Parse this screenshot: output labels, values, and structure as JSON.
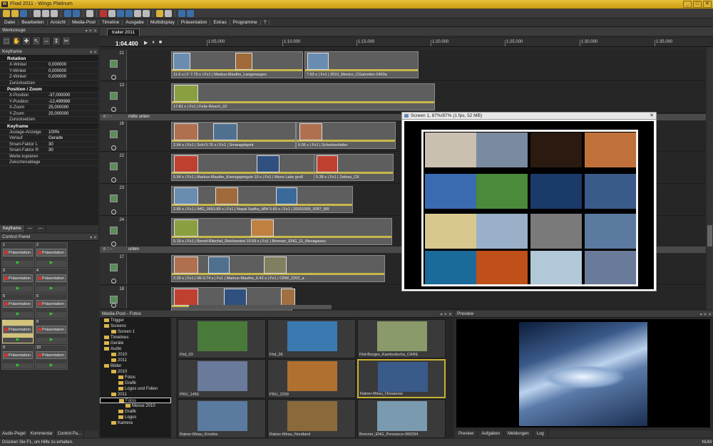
{
  "app": {
    "title": "Fhad 2011 - Wings Platinum",
    "logo": "W"
  },
  "window_controls": [
    "_",
    "□",
    "✕"
  ],
  "menu": [
    "Datei",
    "Bearbeiten",
    "Ansicht",
    "Media-Pool",
    "Timeline",
    "Ausgabe",
    "Multidisplay",
    "Präsentation",
    "Extras",
    "Programme",
    "?"
  ],
  "werkzeuge": {
    "title": "Werkzeuge",
    "tools": [
      "⬚",
      "✋",
      "✚",
      "↖",
      "⇔",
      "⇕",
      "✂"
    ]
  },
  "keyframe": {
    "title": "Keyframe",
    "groups": [
      {
        "name": "Rotation",
        "rows": [
          [
            "X-Winkel",
            "0,000000"
          ],
          [
            "Y-Winkel",
            "0,000000"
          ],
          [
            "Z-Winkel",
            "0,000000"
          ],
          [
            "Zurücksetzen",
            ""
          ]
        ]
      },
      {
        "name": "Position / Zoom",
        "rows": [
          [
            "X-Position",
            "-37,000000"
          ],
          [
            "Y-Position",
            "-12,499989"
          ],
          [
            "X-Zoom",
            "25,000000"
          ],
          [
            "Y-Zoom",
            "25,000000"
          ],
          [
            "Zurücksetzen",
            ""
          ]
        ]
      },
      {
        "name": "Keyframe",
        "rows": [
          [
            "Justage-Anzeige",
            "100%"
          ],
          [
            "Verlauf",
            "Gerade"
          ],
          [
            "Smart-Faktor L",
            "30"
          ],
          [
            "Smart-Faktor R",
            "30"
          ],
          [
            "Werte kopieren",
            ""
          ],
          [
            "Zwischenablage",
            ""
          ]
        ]
      }
    ]
  },
  "left_tabs": [
    "Keyframe",
    "—",
    "—"
  ],
  "control_panel": {
    "title": "Control Panel",
    "cells": [
      {
        "num": "1",
        "label": "Präsentation"
      },
      {
        "num": "2",
        "label": "Präsentation"
      },
      {
        "num": "3",
        "label": "Präsentation"
      },
      {
        "num": "4",
        "label": "Präsentation"
      },
      {
        "num": "5",
        "label": "Präsentation"
      },
      {
        "num": "6",
        "label": "Präsentation"
      },
      {
        "num": "7",
        "label": "Präsentation"
      },
      {
        "num": "8",
        "label": "Präsentation"
      },
      {
        "num": "9",
        "label": "Präsentation"
      },
      {
        "num": "10",
        "label": "Präsentation"
      }
    ]
  },
  "bottom_tabs": [
    "Audio-Pegel",
    "Kommentar",
    "Control Pa..."
  ],
  "status": {
    "text": "Drücken Sie F1, um Hilfe zu erhalten.",
    "indicator": "NUM"
  },
  "timeline": {
    "tab": "trailer 2011",
    "timecode": "1:04.400",
    "transport": [
      "▶",
      "⏸",
      "■"
    ],
    "ticks": [
      "1:05.000",
      "1:10.000",
      "1:15.000",
      "1:20.000",
      "1:25.000",
      "1:30.000",
      "1:35.000"
    ],
    "groups": [
      "mitte unten",
      "unten"
    ],
    "tracks": [
      {
        "num": "21",
        "clips": [
          "11.6 s | F 7.75 s | Fx1 | Markus-Mauthe_Langenargen",
          "7.63 s | Fx1 | 2010_Mexico_CGatcetter-2400a"
        ]
      },
      {
        "num": "13",
        "clips": [
          "17.81 s | Fx1 | Felix-Wesch_02"
        ]
      },
      {
        "num": "16",
        "clips": [
          "2.64 s | Fx1 | Schi 5.76 s | Fx1 | Smaragdspint",
          "6.06 s | Fx1 | Scheckenfalter"
        ]
      },
      {
        "num": "22",
        "clips": [
          "5.54 s | Fx1 | Markus-Mauthe_Koenigspinguin 10 s | Fx1 | Mono Lake groß",
          "5.38 s | Fx1 | Zebras_CK"
        ]
      },
      {
        "num": "23",
        "clips": [
          "2.89 s | Fx1 | IMG_0563.89 s | Fx1 | Nepal Sadhu_MW 5.60 s | Fx1 | 20091009_9287_BR"
        ]
      },
      {
        "num": "24",
        "clips": [
          "5.19 s | Fx1 | Bernd-Ritschel_Reichenstei 10.59 s | Fx1 | Brenner_ENG_11_Mevagissey"
        ]
      },
      {
        "num": "17",
        "clips": [
          "2.29 s | Fx1 | IW-3.74 s | Fx1 | Markus-Mauthe_6.42 s | Fx1 | CRW_2202_a"
        ]
      },
      {
        "num": "18",
        "clips": [
          ""
        ]
      }
    ]
  },
  "screen_window": {
    "title": "Screen 1, 87%/87% (1 fps, 52 MB)",
    "close": "✕"
  },
  "media_pool": {
    "title": "Media-Pool - Fotos",
    "tree": [
      "Trigger",
      "Screens",
      "Screen 1",
      "Timelines",
      "Geräte",
      "Audio",
      "2010",
      "2011",
      "Bilder",
      "2010",
      "Fotos",
      "Grafik",
      "Logos und Folien",
      "2011",
      "Fotos",
      "Messe 2010",
      "Grafik",
      "Logos",
      "Kamera"
    ],
    "thumbs": [
      {
        "caption": "Fhd_03"
      },
      {
        "caption": "Fhd_06"
      },
      {
        "caption": "Fhd-Borges_Kambodscha_CARE"
      },
      {
        "caption": "PRU_1456"
      },
      {
        "caption": "PRU_2209"
      },
      {
        "caption": "Rainer-Mirau_Oesaeuse"
      },
      {
        "caption": "Rainer-Mirau_Korsika"
      },
      {
        "caption": "Rainer-Mirau_Nordland"
      },
      {
        "caption": "Brenner_ENG_Penzance-000294"
      }
    ]
  },
  "preview": {
    "title": "Preview",
    "tabs": [
      "Preview",
      "Aufgaben",
      "Meldungen",
      "Log"
    ]
  },
  "colors": {
    "titlebar": "#d9ac20",
    "clip_bar": "#c8b74a",
    "selection": "#c8b230"
  }
}
